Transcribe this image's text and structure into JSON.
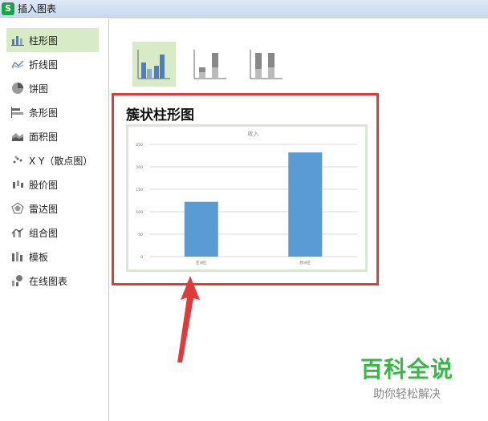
{
  "window": {
    "title": "插入图表",
    "app_icon_letter": "S"
  },
  "sidebar": {
    "items": [
      {
        "label": "柱形图",
        "icon": "column-chart-icon",
        "active": true
      },
      {
        "label": "折线图",
        "icon": "line-chart-icon"
      },
      {
        "label": "饼图",
        "icon": "pie-chart-icon"
      },
      {
        "label": "条形图",
        "icon": "bar-chart-icon"
      },
      {
        "label": "面积图",
        "icon": "area-chart-icon"
      },
      {
        "label": "X Y（散点图）",
        "icon": "scatter-chart-icon"
      },
      {
        "label": "股价图",
        "icon": "stock-chart-icon"
      },
      {
        "label": "雷达图",
        "icon": "radar-chart-icon"
      },
      {
        "label": "组合图",
        "icon": "combo-chart-icon"
      },
      {
        "label": "模板",
        "icon": "template-icon"
      },
      {
        "label": "在线图表",
        "icon": "online-chart-icon"
      }
    ]
  },
  "subtypes": [
    {
      "name": "clustered-column",
      "active": true
    },
    {
      "name": "stacked-column"
    },
    {
      "name": "percent-stacked-column"
    }
  ],
  "preview": {
    "title": "簇状柱形图",
    "chart_data": {
      "type": "bar",
      "title": "收入",
      "categories": [
        "亚洲区",
        "欧洲区"
      ],
      "values": [
        122,
        232
      ],
      "ylim": [
        0,
        250
      ],
      "yticks": [
        0,
        50,
        100,
        150,
        200,
        250
      ],
      "ytick_labels": [
        "0",
        "50",
        "100",
        "150",
        "200",
        "250"
      ],
      "bar_color": "#5b9bd5",
      "grid": true
    }
  },
  "watermark": {
    "title": "百科全说",
    "subtitle": "助你轻松解决"
  },
  "colors": {
    "accent_green": "#d7ebc6",
    "highlight_red": "#e13a3a",
    "bar_blue": "#5b9bd5"
  }
}
